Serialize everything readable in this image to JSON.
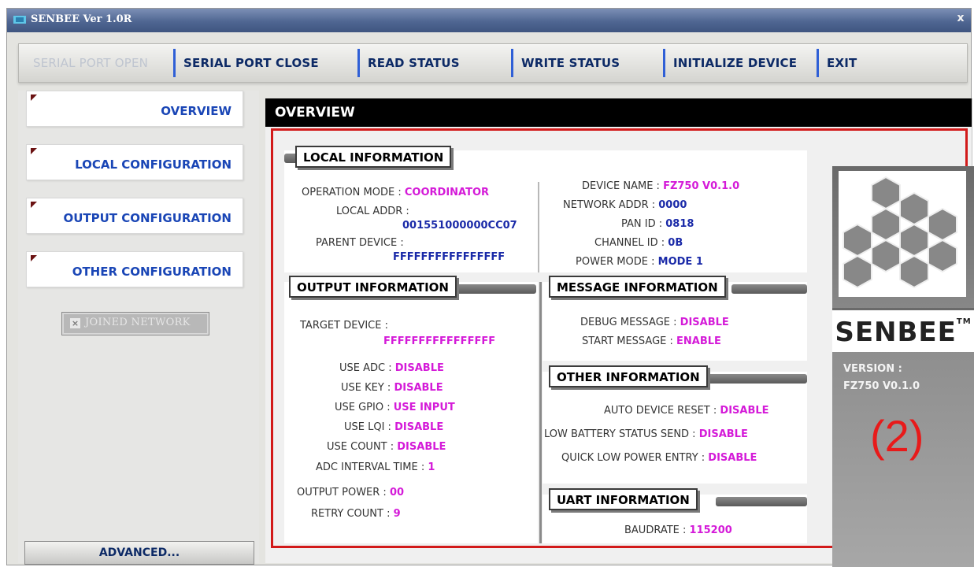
{
  "window": {
    "title": "SENBEE Ver 1.0R",
    "close_glyph": "x"
  },
  "toolbar": {
    "serial_open": "SERIAL PORT OPEN",
    "serial_close": "SERIAL PORT CLOSE",
    "read_status": "READ STATUS",
    "write_status": "WRITE STATUS",
    "initialize_device": "INITIALIZE DEVICE",
    "exit": "EXIT"
  },
  "sidebar": {
    "items": [
      {
        "label": "OVERVIEW"
      },
      {
        "label": "LOCAL CONFIGURATION"
      },
      {
        "label": "OUTPUT CONFIGURATION"
      },
      {
        "label": "OTHER CONFIGURATION"
      }
    ],
    "joined_network": {
      "label": "JOINED NETWORK",
      "checked": false
    },
    "advanced": "ADVANCED..."
  },
  "overview": {
    "header": "OVERVIEW",
    "local_information": {
      "title": "LOCAL INFORMATION",
      "operation_mode_label": "OPERATION MODE :",
      "operation_mode_value": "COORDINATOR",
      "local_addr_label": "LOCAL ADDR :",
      "local_addr_value": "001551000000CC07",
      "parent_device_label": "PARENT DEVICE :",
      "parent_device_value": "FFFFFFFFFFFFFFFF",
      "device_name_label": "DEVICE NAME :",
      "device_name_value": "FZ750 V0.1.0",
      "network_addr_label": "NETWORK ADDR :",
      "network_addr_value": "0000",
      "pan_id_label": "PAN ID :",
      "pan_id_value": "0818",
      "channel_id_label": "CHANNEL ID :",
      "channel_id_value": "0B",
      "power_mode_label": "POWER MODE :",
      "power_mode_value": "MODE 1"
    },
    "output_information": {
      "title": "OUTPUT INFORMATION",
      "target_device_label": "TARGET DEVICE :",
      "target_device_value": "FFFFFFFFFFFFFFFF",
      "use_adc_label": "USE ADC :",
      "use_adc_value": "DISABLE",
      "use_key_label": "USE KEY :",
      "use_key_value": "DISABLE",
      "use_gpio_label": "USE GPIO :",
      "use_gpio_value": "USE INPUT",
      "use_lqi_label": "USE LQI :",
      "use_lqi_value": "DISABLE",
      "use_count_label": "USE COUNT :",
      "use_count_value": "DISABLE",
      "adc_interval_label": "ADC INTERVAL TIME :",
      "adc_interval_value": "1",
      "output_power_label": "OUTPUT POWER :",
      "output_power_value": "00",
      "retry_count_label": "RETRY COUNT :",
      "retry_count_value": "9"
    },
    "message_information": {
      "title": "MESSAGE INFORMATION",
      "debug_message_label": "DEBUG MESSAGE :",
      "debug_message_value": "DISABLE",
      "start_message_label": "START MESSAGE :",
      "start_message_value": "ENABLE"
    },
    "other_information": {
      "title": "OTHER INFORMATION",
      "auto_reset_label": "AUTO DEVICE RESET :",
      "auto_reset_value": "DISABLE",
      "low_battery_label": "LOW BATTERY STATUS SEND :",
      "low_battery_value": "DISABLE",
      "quick_low_power_label": "QUICK LOW POWER ENTRY :",
      "quick_low_power_value": "DISABLE"
    },
    "uart_information": {
      "title": "UART INFORMATION",
      "baudrate_label": "BAUDRATE :",
      "baudrate_value": "115200"
    },
    "brand": {
      "logo_icon": "hexagon-cluster-logo",
      "name": "SENBEE",
      "trademark": "TM",
      "version_label": "VERSION :",
      "version_value": "FZ750 V0.1.0",
      "annotation": "(2)"
    }
  },
  "colors": {
    "value_magenta": "#d41ad8",
    "value_blue": "#1a2aa8",
    "nav_blue": "#1a46b6",
    "annotation_red": "#d21a1a"
  }
}
